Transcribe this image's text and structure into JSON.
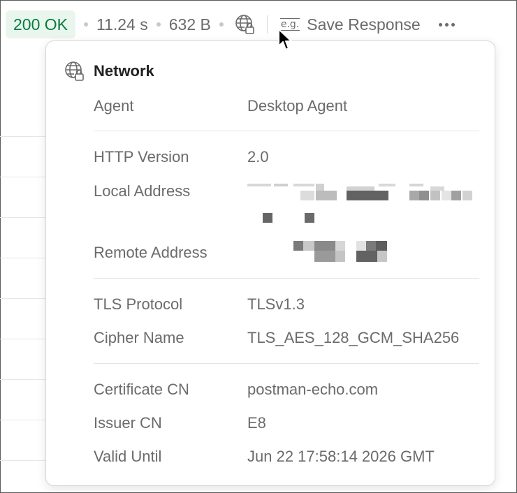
{
  "statusbar": {
    "status": "200 OK",
    "time": "11.24 s",
    "size": "632 B",
    "eg_label": "e.g.",
    "save_label": "Save Response"
  },
  "colors": {
    "status_ok_bg": "#e8f6ee",
    "status_ok_text": "#0a7a3f",
    "muted_text": "#6b6b6b",
    "title_text": "#212121",
    "divider": "#e4e4e4"
  },
  "icons": {
    "network": "globe-lock-icon",
    "save": "example-icon",
    "more": "more-horizontal-icon",
    "cursor": "mouse-pointer-icon"
  },
  "network_panel": {
    "title": "Network",
    "agent": {
      "label": "Agent",
      "value": "Desktop Agent"
    },
    "http_version": {
      "label": "HTTP Version",
      "value": "2.0"
    },
    "local_address": {
      "label": "Local Address"
    },
    "remote_address": {
      "label": "Remote Address"
    },
    "tls_protocol": {
      "label": "TLS Protocol",
      "value": "TLSv1.3"
    },
    "cipher_name": {
      "label": "Cipher Name",
      "value": "TLS_AES_128_GCM_SHA256"
    },
    "certificate_cn": {
      "label": "Certificate CN",
      "value": "postman-echo.com"
    },
    "issuer_cn": {
      "label": "Issuer CN",
      "value": "E8"
    },
    "valid_until": {
      "label": "Valid Until",
      "value": "Jun 22 17:58:14 2026 GMT"
    }
  }
}
